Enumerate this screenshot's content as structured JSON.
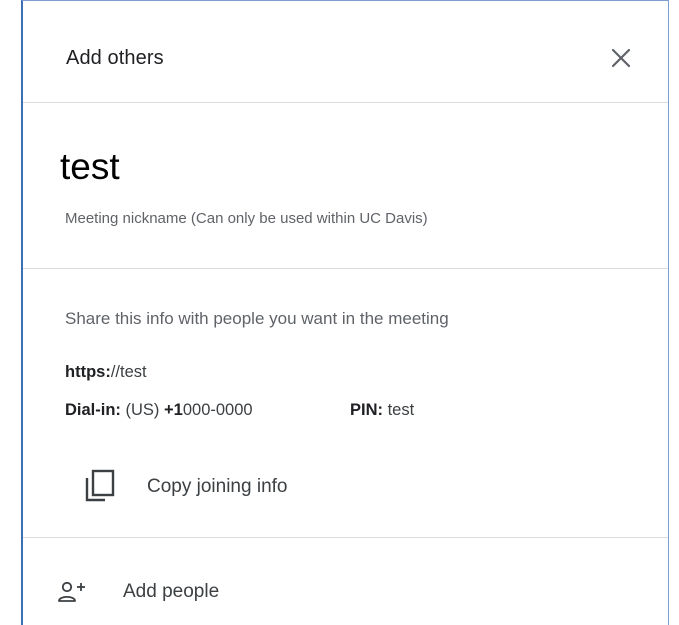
{
  "dialog": {
    "title": "Add others",
    "close_icon": "close-icon"
  },
  "nickname": {
    "value": "test",
    "caption": "Meeting nickname (Can only be used within UC Davis)"
  },
  "share": {
    "intro": "Share this info with people you want in the meeting",
    "link_scheme": "https:",
    "link_rest": "//test",
    "dial_label": "Dial-in:",
    "dial_region": "(US)",
    "dial_prefix": "+1",
    "dial_number": "000-0000",
    "pin_label": "PIN:",
    "pin_value": "test",
    "copy_icon": "copy-icon",
    "copy_label": "Copy joining info"
  },
  "add_people": {
    "icon": "person-add-icon",
    "label": "Add people"
  },
  "colors": {
    "text_primary": "#202124",
    "text_secondary": "#5f6368",
    "divider": "#dadce0",
    "frame_border": "#3d6fb6"
  }
}
